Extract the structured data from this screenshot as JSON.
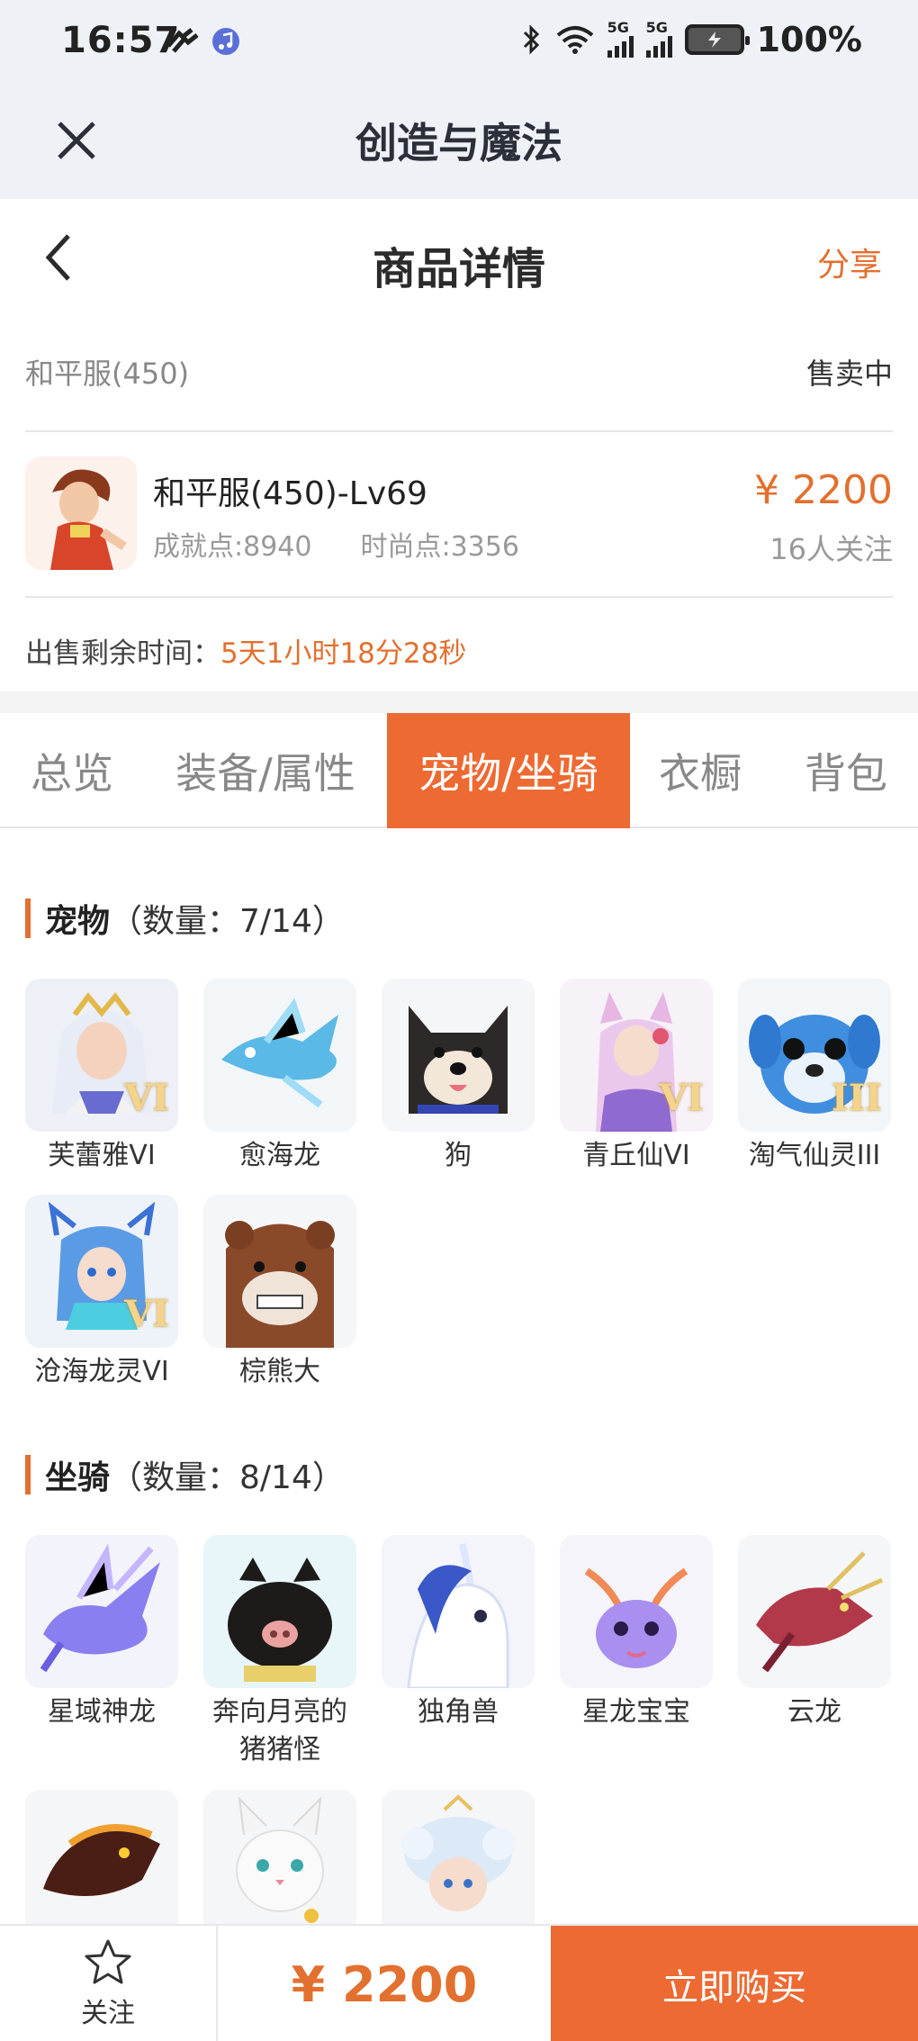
{
  "status": {
    "time": "16:57",
    "net1": "5G",
    "net2": "5G",
    "battery": "100%"
  },
  "app": {
    "title": "创造与魔法"
  },
  "nav": {
    "title": "商品详情",
    "share": "分享"
  },
  "server": {
    "name": "和平服(450)",
    "status": "售卖中"
  },
  "item": {
    "name": "和平服(450)-Lv69",
    "achievement": "成就点:8940",
    "fashion": "时尚点:3356",
    "price": "¥ 2200",
    "watchers": "16人关注"
  },
  "remaining": {
    "label": "出售剩余时间：",
    "value": "5天1小时18分28秒"
  },
  "tabs": [
    "总览",
    "装备/属性",
    "宠物/坐骑",
    "衣橱",
    "背包"
  ],
  "pets": {
    "title": "宠物",
    "count": "（数量：7/14）",
    "items": [
      {
        "label": "芙蕾雅VI",
        "badge": "VI"
      },
      {
        "label": "愈海龙",
        "badge": ""
      },
      {
        "label": "狗",
        "badge": ""
      },
      {
        "label": "青丘仙VI",
        "badge": "VI"
      },
      {
        "label": "淘气仙灵III",
        "badge": "III"
      },
      {
        "label": "沧海龙灵VI",
        "badge": "VI"
      },
      {
        "label": "棕熊大",
        "badge": ""
      }
    ]
  },
  "mounts": {
    "title": "坐骑",
    "count": "（数量：8/14）",
    "items": [
      {
        "label": "星域神龙"
      },
      {
        "label": "奔向月亮的猪猪怪"
      },
      {
        "label": "独角兽"
      },
      {
        "label": "星龙宝宝"
      },
      {
        "label": "云龙"
      },
      {
        "label": ""
      },
      {
        "label": ""
      },
      {
        "label": ""
      }
    ]
  },
  "bottom": {
    "follow": "关注",
    "price": "¥ 2200",
    "buy": "立即购买"
  },
  "colors": {
    "accent": "#ed6a33",
    "price": "#e2702f",
    "header_bg": "#eef2f7"
  }
}
